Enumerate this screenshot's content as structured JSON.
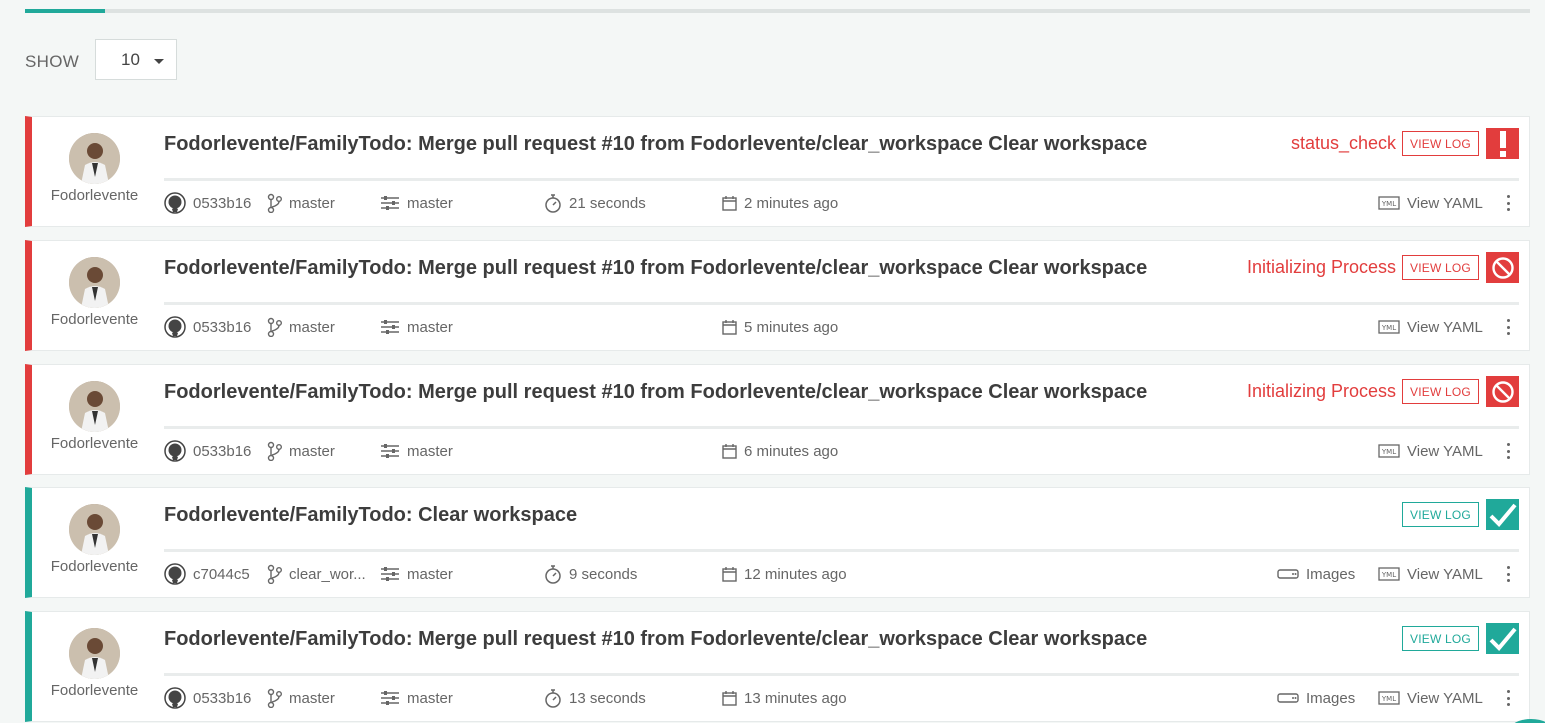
{
  "progress": {
    "fraction": 0.053
  },
  "show": {
    "label": "SHOW",
    "value": "10"
  },
  "builds": [
    {
      "author": "Fodorlevente",
      "title": "Fodorlevente/FamilyTodo: Merge pull request #10 from Fodorlevente/clear_workspace Clear workspace",
      "state": "failed",
      "status": "status_check",
      "status_icon": "exclamation-icon",
      "view_log": "VIEW LOG",
      "commit": "0533b16",
      "branch": "master",
      "target": "master",
      "duration": "21 seconds",
      "time": "2 minutes ago",
      "images": "",
      "view_yaml": "View YAML"
    },
    {
      "author": "Fodorlevente",
      "title": "Fodorlevente/FamilyTodo: Merge pull request #10 from Fodorlevente/clear_workspace Clear workspace",
      "state": "failed",
      "status": "Initializing Process",
      "status_icon": "blocked-icon",
      "view_log": "VIEW LOG",
      "commit": "0533b16",
      "branch": "master",
      "target": "master",
      "duration": "",
      "time": "5 minutes ago",
      "images": "",
      "view_yaml": "View YAML"
    },
    {
      "author": "Fodorlevente",
      "title": "Fodorlevente/FamilyTodo: Merge pull request #10 from Fodorlevente/clear_workspace Clear workspace",
      "state": "failed",
      "status": "Initializing Process",
      "status_icon": "blocked-icon",
      "view_log": "VIEW LOG",
      "commit": "0533b16",
      "branch": "master",
      "target": "master",
      "duration": "",
      "time": "6 minutes ago",
      "images": "",
      "view_yaml": "View YAML"
    },
    {
      "author": "Fodorlevente",
      "title": "Fodorlevente/FamilyTodo: Clear workspace",
      "state": "success",
      "status": "",
      "status_icon": "check-icon",
      "view_log": "VIEW LOG",
      "commit": "c7044c5",
      "branch": "clear_wor...",
      "target": "master",
      "duration": "9 seconds",
      "time": "12 minutes ago",
      "images": "Images",
      "view_yaml": "View YAML"
    },
    {
      "author": "Fodorlevente",
      "title": "Fodorlevente/FamilyTodo: Merge pull request #10 from Fodorlevente/clear_workspace Clear workspace",
      "state": "success",
      "status": "",
      "status_icon": "check-icon",
      "view_log": "VIEW LOG",
      "commit": "0533b16",
      "branch": "master",
      "target": "master",
      "duration": "13 seconds",
      "time": "13 minutes ago",
      "images": "Images",
      "view_yaml": "View YAML"
    }
  ],
  "colors": {
    "failed": "#e23d3d",
    "success": "#20a99a"
  }
}
